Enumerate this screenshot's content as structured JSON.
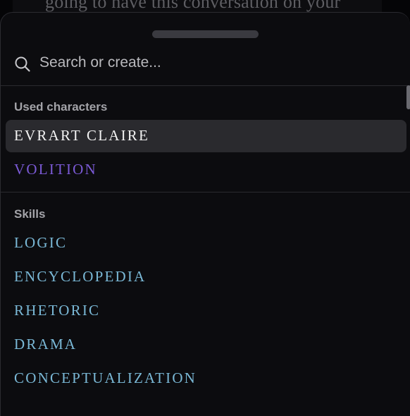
{
  "background_document": {
    "text": "going to have this conversation on your"
  },
  "search": {
    "placeholder": "Search or create...",
    "icon": "search-icon"
  },
  "sections": {
    "used_characters": {
      "header": "Used characters",
      "items": [
        {
          "label": "EVRART CLAIRE",
          "color": "#f2f2f2",
          "selected": true
        },
        {
          "label": "VOLITION",
          "color": "#7b5ad6",
          "selected": false
        }
      ]
    },
    "skills": {
      "header": "Skills",
      "items": [
        {
          "label": "LOGIC",
          "color": "#7ab8d6"
        },
        {
          "label": "ENCYCLOPEDIA",
          "color": "#7ab8d6"
        },
        {
          "label": "RHETORIC",
          "color": "#7ab8d6"
        },
        {
          "label": "DRAMA",
          "color": "#7ab8d6"
        },
        {
          "label": "CONCEPTUALIZATION",
          "color": "#7ab8d6"
        }
      ]
    }
  },
  "colors": {
    "sheet_background": "#0c0c0f",
    "selected_row": "#2a2a2e",
    "section_header": "#a3a3a8"
  }
}
